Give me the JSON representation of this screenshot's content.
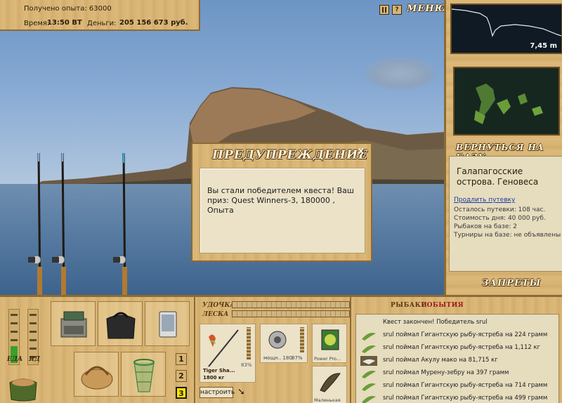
{
  "top_panel": {
    "exp_received": "Получено опыта: 63000",
    "time_label": "Время:",
    "time_value": "13:50 ВТ",
    "money_label": "Деньги:",
    "money_value": "205 156 673 руб."
  },
  "menu": {
    "pause_icon": "pause-icon",
    "help_label": "?",
    "menu_label": "МЕНЮ"
  },
  "depth": {
    "value": "7,45 m"
  },
  "right_panel": {
    "return_label": "ВЕРНУТЬСЯ НА БАЗУ",
    "location": "Галапагосские острова. Геновеса",
    "extend_link": "Продлить путевку",
    "stats": [
      "Осталось путевки: 108 час.",
      "Стоимость дня: 40 000 руб.",
      "Рыбаков на базе: 2",
      "Турниры на базе: не объявлены"
    ],
    "bans_label": "ЗАПРЕТЫ"
  },
  "dialog": {
    "title": "ПРЕДУПРЕЖДЕНИЕ",
    "close_label": "x",
    "message": "Вы стали победителем квеста! Ваш приз: Quest Winners-3, 180000 , Опыта"
  },
  "bottom": {
    "gauges": [
      {
        "label": "ЕДА",
        "level": 0.3,
        "color": "#3aa02a"
      },
      {
        "label": "ЯД",
        "level": 0,
        "color": "#3aa02a"
      }
    ],
    "slot_numbers": [
      "1",
      "2",
      "3"
    ],
    "active_slot": "3"
  },
  "tackle": {
    "rod_label": "УДОЧКА",
    "line_label": "ЛЕСКА",
    "rod_name": "Tiger Sha...",
    "rod_capacity": "1800 кг",
    "rod_wear": "83%",
    "reel_name": "мощн.. 18G",
    "reel_wear": "87%",
    "line_name": "Power Pro...",
    "bait_name": "Маленькая",
    "setup_button": "настроить"
  },
  "events": {
    "tab_fishers": "РЫБАКИ",
    "tab_events": "СОБЫТИЯ",
    "items": [
      {
        "text": "Квест закончен! Победитель srul",
        "icon": "none"
      },
      {
        "text": "srul поймал Гигантскую рыбу-ястреба на 224 грамм",
        "icon": "fish-green"
      },
      {
        "text": "srul поймал Гигантскую рыбу-ястреба на 1,112 кг",
        "icon": "fish-green"
      },
      {
        "text": "srul поймал Акулу мако на 81,715 кг",
        "icon": "fish-shark"
      },
      {
        "text": "srul поймал Мурену-зебру на 397 грамм",
        "icon": "fish-green"
      },
      {
        "text": "srul поймал Гигантскую рыбу-ястреба на 714 грамм",
        "icon": "fish-green"
      },
      {
        "text": "srul поймал Гигантскую рыбу-ястреба на 499 грамм",
        "icon": "fish-green"
      }
    ]
  }
}
